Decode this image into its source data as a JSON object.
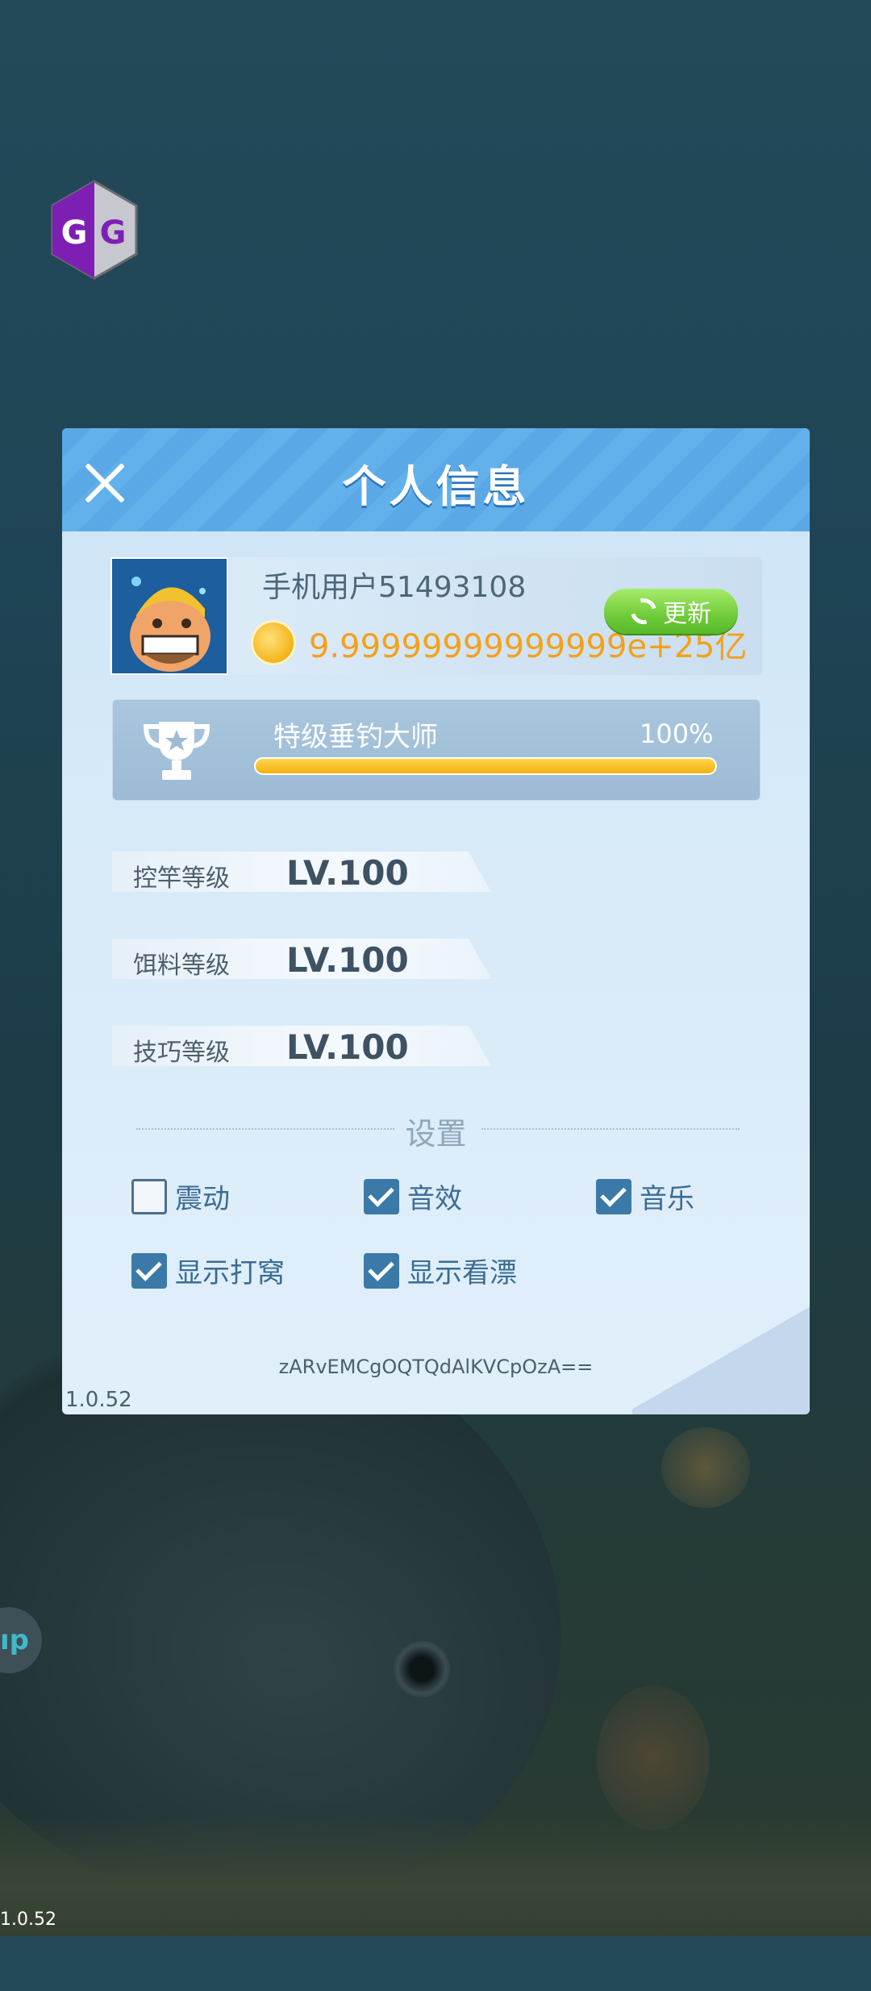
{
  "panel": {
    "title": "个人信息",
    "version": "1.0.52",
    "token": "zARvEMCgOQTQdAlKVCpOzA=="
  },
  "profile": {
    "username": "手机用户51493108",
    "coins": "9.99999999999999e+25亿",
    "update_label": "更新"
  },
  "rank": {
    "title": "特级垂钓大师",
    "progress_text": "100%",
    "progress": 1.0
  },
  "levels": [
    {
      "label": "控竿等级",
      "value": "LV.100"
    },
    {
      "label": "饵料等级",
      "value": "LV.100"
    },
    {
      "label": "技巧等级",
      "value": "LV.100"
    }
  ],
  "settings": {
    "title": "设置",
    "options": [
      {
        "label": "震动",
        "checked": false
      },
      {
        "label": "音效",
        "checked": true
      },
      {
        "label": "音乐",
        "checked": true
      },
      {
        "label": "显示打窝",
        "checked": true
      },
      {
        "label": "显示看漂",
        "checked": true
      }
    ]
  },
  "overlay": {
    "bubble_text": "ıp",
    "corner_version": "1.0.52"
  },
  "colors": {
    "accent_blue": "#5aa9e6",
    "coin_orange": "#f4a11a",
    "update_green": "#6fcb39",
    "checkbox_blue": "#3b7aa8"
  }
}
